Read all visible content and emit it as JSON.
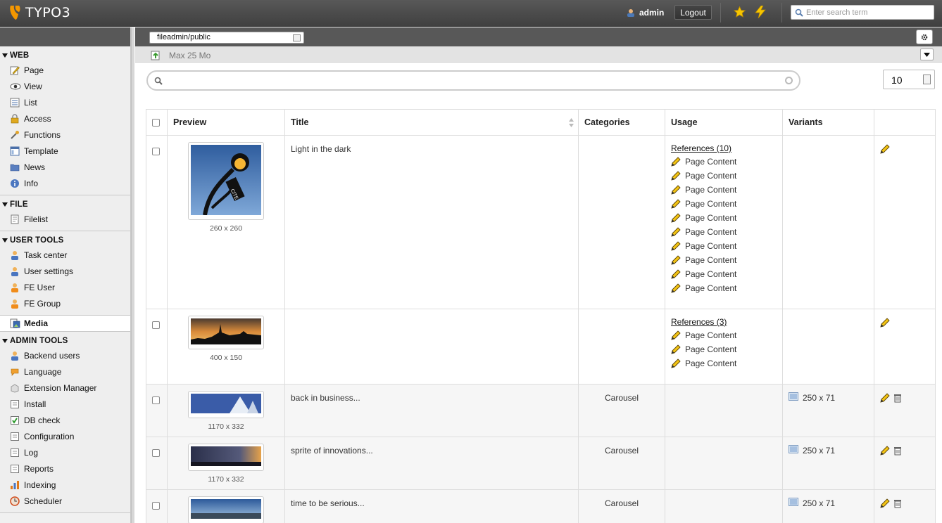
{
  "app": {
    "logo_text": "TYPO3",
    "user": "admin",
    "logout": "Logout",
    "search_placeholder": "Enter search term",
    "brand_color": "#f49700"
  },
  "sidebar": {
    "groups": [
      {
        "title": "WEB",
        "items": [
          "Page",
          "View",
          "List",
          "Access",
          "Functions",
          "Template",
          "News",
          "Info"
        ]
      },
      {
        "title": "FILE",
        "items": [
          "Filelist"
        ]
      },
      {
        "title": "USER TOOLS",
        "items": [
          "Task center",
          "User settings",
          "FE User",
          "FE Group"
        ]
      },
      {
        "title": "ADMIN TOOLS",
        "items": [
          "Backend users",
          "Language",
          "Extension Manager",
          "Install",
          "DB check",
          "Configuration",
          "Log",
          "Reports",
          "Indexing",
          "Scheduler"
        ]
      }
    ],
    "active_item": "Media"
  },
  "toolbar": {
    "folder": "fileadmin/public",
    "max_size": "Max 25 Mo",
    "page_size": "10"
  },
  "table": {
    "headers": {
      "preview": "Preview",
      "title": "Title",
      "categories": "Categories",
      "usage": "Usage",
      "variants": "Variants"
    },
    "rows": [
      {
        "title": "Light in the dark",
        "dims": "260 x 260",
        "categories": "",
        "references": "References (10)",
        "refs": [
          "Page Content",
          "Page Content",
          "Page Content",
          "Page Content",
          "Page Content",
          "Page Content",
          "Page Content",
          "Page Content",
          "Page Content",
          "Page Content"
        ],
        "variant": ""
      },
      {
        "title": "",
        "dims": "400 x 150",
        "categories": "",
        "references": "References (3)",
        "refs": [
          "Page Content",
          "Page Content",
          "Page Content"
        ],
        "variant": ""
      },
      {
        "title": "back in business...",
        "dims": "1170 x 332",
        "categories": "Carousel",
        "references": "",
        "refs": [],
        "variant": "250 x 71"
      },
      {
        "title": "sprite of innovations...",
        "dims": "1170 x 332",
        "categories": "Carousel",
        "references": "",
        "refs": [],
        "variant": "250 x 71"
      },
      {
        "title": "time to be serious...",
        "dims": "",
        "categories": "Carousel",
        "references": "",
        "refs": [],
        "variant": "250 x 71"
      }
    ]
  }
}
